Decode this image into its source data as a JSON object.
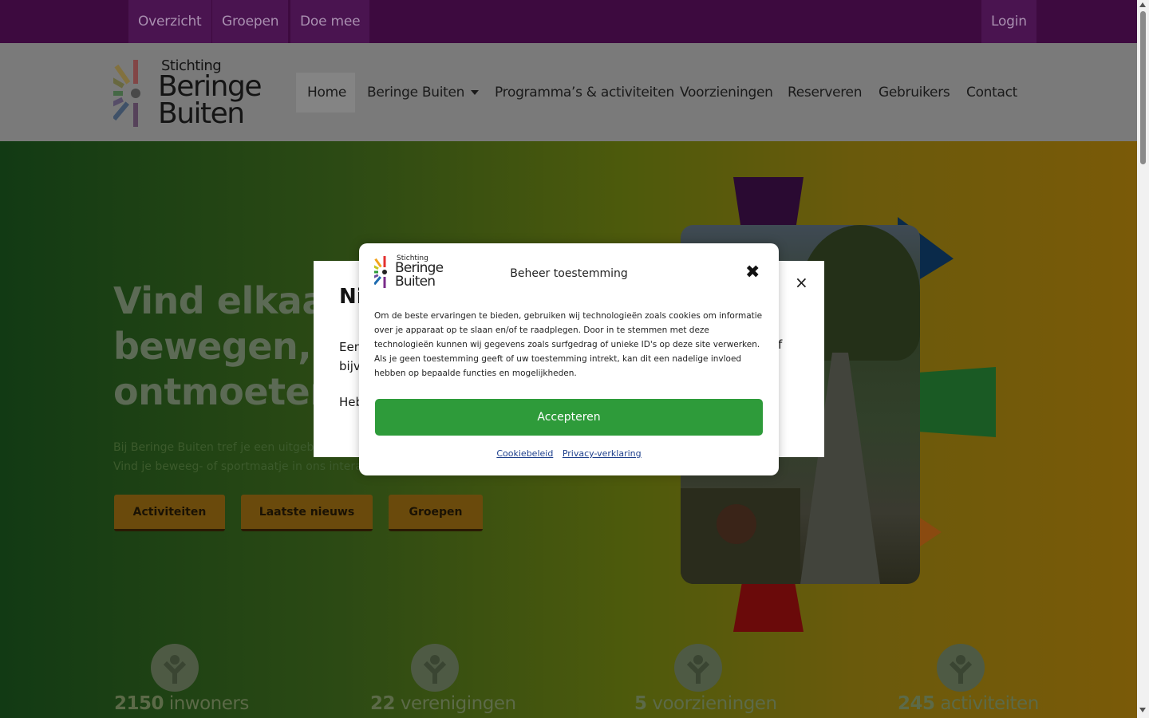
{
  "topbar": {
    "items": [
      "Overzicht",
      "Groepen",
      "Doe mee"
    ],
    "login": "Login"
  },
  "logo": {
    "line1": "Stichting",
    "line2": "Beringe",
    "line3": "Buiten"
  },
  "nav": {
    "items": [
      "Home",
      "Beringe Buiten",
      "Programma’s & activiteiten",
      "Voorzieningen",
      "Reserveren",
      "Gebruikers",
      "Contact"
    ],
    "active": "Home"
  },
  "hero": {
    "title_lines": [
      "Vind elkaar o",
      "bewegen, sp",
      "ontmoeten."
    ],
    "text_lines": [
      "Bij Beringe Buiten tref je een uitgebre",
      "Vind je beweeg- of sportmaatje in ons interac"
    ],
    "buttons": [
      "Activiteiten",
      "Laatste nieuws",
      "Groepen"
    ]
  },
  "stats": [
    {
      "number": "2150",
      "label": "inwoners"
    },
    {
      "number": "22",
      "label": "verenigingen"
    },
    {
      "number": "5",
      "label": "voorzieningen"
    },
    {
      "number": "245",
      "label": "activiteiten"
    }
  ],
  "newsletter_popup": {
    "title_visible": "Ni",
    "text1_visible": "Een bijvo",
    "text2_visible": "Heb",
    "right_visible": "f",
    "close": "×"
  },
  "cookie": {
    "title": "Beheer toestemming",
    "close": "✖",
    "text": "Om de beste ervaringen te bieden, gebruiken wij technologieën zoals cookies om informatie over je apparaat op te slaan en/of te raadplegen. Door in te stemmen met deze technologieën kunnen wij gegevens zoals surfgedrag of unieke ID's op deze site verwerken. Als je geen toestemming geeft of uw toestemming intrekt, kan dit een nadelige invloed hebben op bepaalde functies en mogelijkheden.",
    "accept": "Accepteren",
    "links": [
      "Cookiebeleid",
      "Privacy-verklaring"
    ],
    "logo": {
      "line1": "Stichting",
      "line2": "Beringe",
      "line3": "Buiten"
    }
  },
  "colors": {
    "topbar": "#3d0a3f",
    "accept": "#2e9b3a",
    "link": "#1d3f8c"
  }
}
